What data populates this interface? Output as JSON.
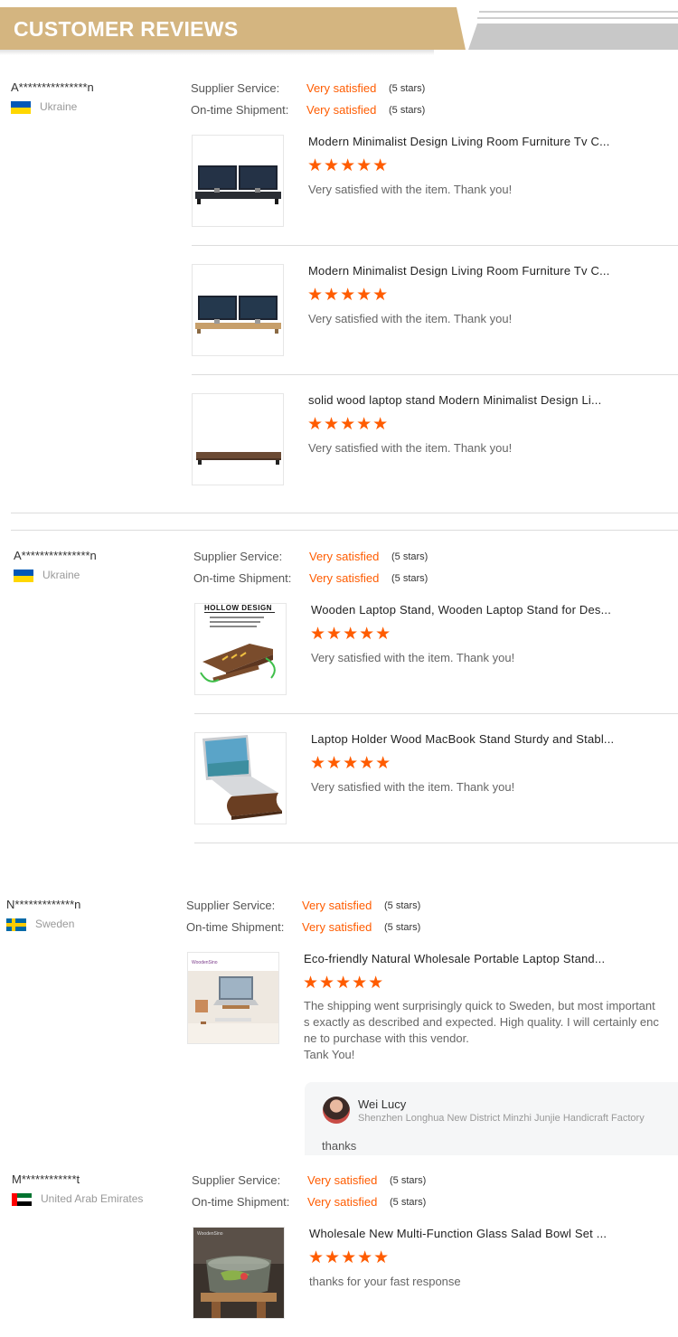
{
  "header": {
    "title": "CUSTOMER REVIEWS"
  },
  "labels": {
    "supplier_service": "Supplier Service:",
    "on_time_shipment": "On-time Shipment:"
  },
  "reviews": [
    {
      "buyer": "A***************n",
      "country": "Ukraine",
      "flag_colors": [
        "#0057b7",
        "#ffd700"
      ],
      "supplier_service": "Very satisfied",
      "supplier_stars": "(5 stars)",
      "shipment": "Very satisfied",
      "shipment_stars": "(5 stars)",
      "products": [
        {
          "title": "Modern Minimalist Design Living Room Furniture Tv C...",
          "stars": "★★★★★",
          "rating": 5,
          "comment": "Very satisfied with the item. Thank you!",
          "image": "dual-monitor-dark-stand-icon"
        },
        {
          "title": "Modern Minimalist Design Living Room Furniture Tv C...",
          "stars": "★★★★★",
          "rating": 5,
          "comment": "Very satisfied with the item. Thank you!",
          "image": "dual-monitor-wood-stand-icon"
        },
        {
          "title": "solid wood laptop stand Modern Minimalist Design Li...",
          "stars": "★★★★★",
          "rating": 5,
          "comment": "Very satisfied with the item. Thank you!",
          "image": "wood-shelf-icon"
        }
      ]
    },
    {
      "buyer": "A***************n",
      "country": "Ukraine",
      "flag_colors": [
        "#0057b7",
        "#ffd700"
      ],
      "supplier_service": "Very satisfied",
      "supplier_stars": "(5 stars)",
      "shipment": "Very satisfied",
      "shipment_stars": "(5 stars)",
      "products": [
        {
          "title": "Wooden Laptop Stand, Wooden Laptop Stand for Des...",
          "stars": "★★★★★",
          "rating": 5,
          "comment": "Very satisfied with the item. Thank you!",
          "image": "hollow-design-stand-icon",
          "image_text": "HOLLOW DESIGN"
        },
        {
          "title": "Laptop Holder Wood MacBook Stand Sturdy and Stabl...",
          "stars": "★★★★★",
          "rating": 5,
          "comment": "Very satisfied with the item. Thank you!",
          "image": "laptop-on-stand-icon"
        }
      ]
    },
    {
      "buyer": "N*************n",
      "country": "Sweden",
      "flag_colors": [
        "#006aa7",
        "#fecc00"
      ],
      "supplier_service": "Very satisfied",
      "supplier_stars": "(5 stars)",
      "shipment": "Very satisfied",
      "shipment_stars": "(5 stars)",
      "products": [
        {
          "title": "Eco-friendly Natural Wholesale Portable Laptop Stand...",
          "stars": "★★★★★",
          "rating": 5,
          "comment_lines": [
            "The shipping went surprisingly quick to Sweden, but most important",
            "s exactly as described and expected.  High quality. I will certainly enc",
            "ne to purchase with this vendor.",
            "Tank You!"
          ],
          "image": "desk-laptop-stand-icon",
          "image_text": "WoodenSino"
        }
      ],
      "reply": {
        "name": "Wei Lucy",
        "company": "Shenzhen Longhua New District Minzhi Junjie Handicraft Factory",
        "text": "thanks"
      }
    },
    {
      "buyer": "M************t",
      "country": "United Arab Emirates",
      "flag_colors": [
        "#ff0000",
        "#00732f",
        "#ffffff",
        "#000000"
      ],
      "supplier_service": "Very satisfied",
      "supplier_stars": "(5 stars)",
      "shipment": "Very satisfied",
      "shipment_stars": "(5 stars)",
      "products": [
        {
          "title": "Wholesale New Multi-Function Glass Salad Bowl Set ...",
          "stars": "★★★★★",
          "rating": 5,
          "comment": "thanks for your fast response",
          "image": "glass-salad-bowl-icon",
          "image_text": "WoodenSino"
        }
      ]
    }
  ]
}
